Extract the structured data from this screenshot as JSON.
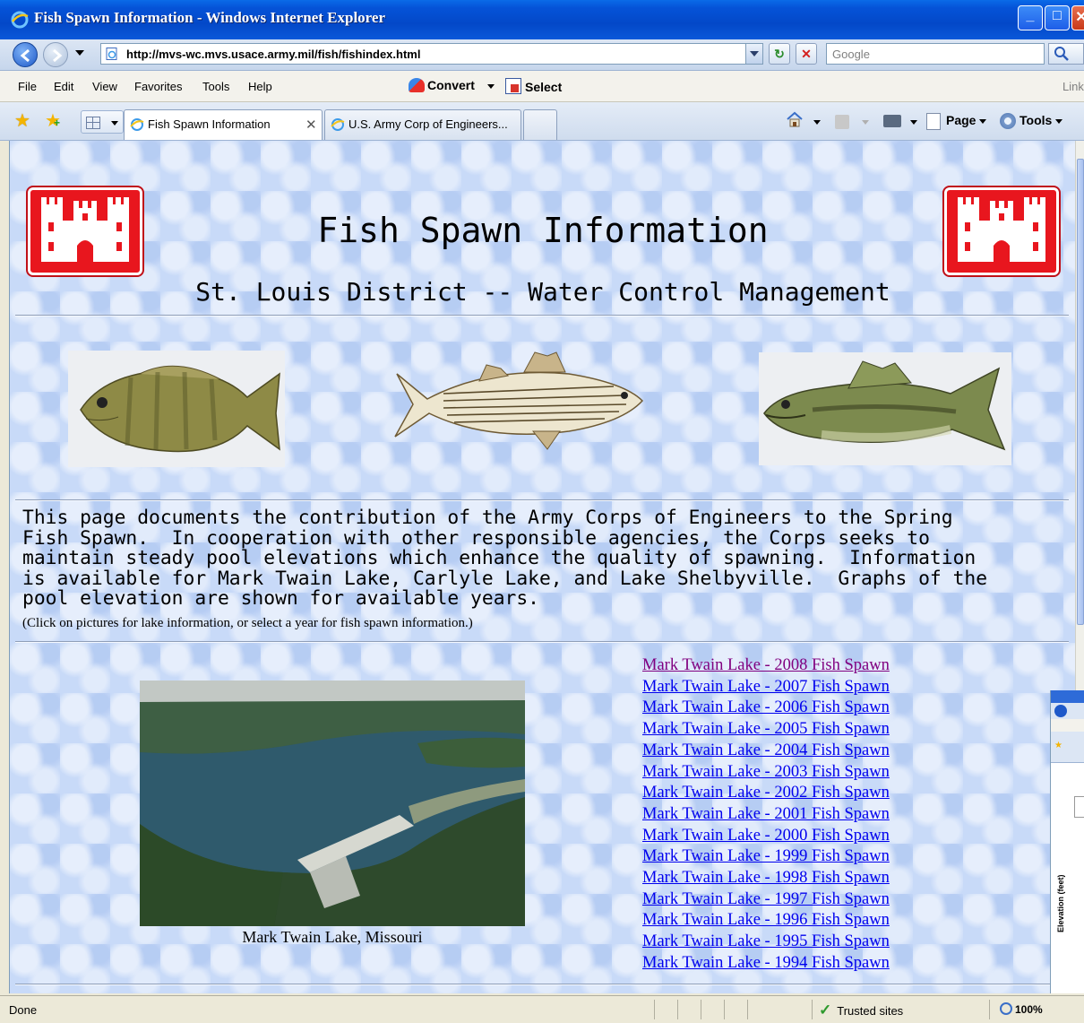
{
  "window": {
    "title": "Fish Spawn Information - Windows Internet Explorer"
  },
  "address_bar": {
    "url": "http://mvs-wc.mvs.usace.army.mil/fish/fishindex.html",
    "search_placeholder": "Google"
  },
  "menu": {
    "items": [
      "File",
      "Edit",
      "View",
      "Favorites",
      "Tools",
      "Help"
    ],
    "convert_label": "Convert",
    "select_label": "Select",
    "links_label": "Link"
  },
  "tabs": [
    {
      "label": "Fish Spawn Information",
      "active": true
    },
    {
      "label": "U.S. Army Corp of Engineers...",
      "active": false
    }
  ],
  "command_bar": {
    "page_label": "Page",
    "tools_label": "Tools"
  },
  "page": {
    "title": "Fish Spawn Information",
    "subtitle": "St. Louis District -- Water Control Management",
    "intro_lines": [
      "This page documents the contribution of the Army Corps of Engineers to the Spring",
      "Fish Spawn.  In cooperation with other responsible agencies, the Corps seeks to",
      "maintain steady pool elevations which enhance the quality of spawning.  Information",
      "is available for Mark Twain Lake, Carlyle Lake, and Lake Shelbyville.  Graphs of the",
      "pool elevation are shown for available years."
    ],
    "note": "(Click on pictures for lake information, or select a year for fish spawn information.)",
    "lake_caption": "Mark Twain Lake, Missouri",
    "links": [
      {
        "label": "Mark Twain Lake - 2008 Fish Spawn",
        "visited": true
      },
      {
        "label": "Mark Twain Lake - 2007 Fish Spawn",
        "visited": false
      },
      {
        "label": "Mark Twain Lake - 2006 Fish Spawn",
        "visited": false
      },
      {
        "label": "Mark Twain Lake - 2005 Fish Spawn",
        "visited": false
      },
      {
        "label": "Mark Twain Lake - 2004 Fish Spawn",
        "visited": false
      },
      {
        "label": "Mark Twain Lake - 2003 Fish Spawn",
        "visited": false
      },
      {
        "label": "Mark Twain Lake - 2002 Fish Spawn",
        "visited": false
      },
      {
        "label": "Mark Twain Lake - 2001 Fish Spawn",
        "visited": false
      },
      {
        "label": "Mark Twain Lake - 2000 Fish Spawn",
        "visited": false
      },
      {
        "label": "Mark Twain Lake - 1999 Fish Spawn",
        "visited": false
      },
      {
        "label": "Mark Twain Lake - 1998 Fish Spawn ",
        "visited": false
      },
      {
        "label": "Mark Twain Lake - 1997 Fish Spawn",
        "visited": false
      },
      {
        "label": "Mark Twain Lake - 1996 Fish Spawn",
        "visited": false
      },
      {
        "label": "Mark Twain Lake - 1995 Fish Spawn",
        "visited": false
      },
      {
        "label": "Mark Twain Lake - 1994 Fish Spawn",
        "visited": false
      }
    ]
  },
  "side_window": {
    "axis_label": "Elevation (feet)"
  },
  "status_bar": {
    "text": "Done",
    "zone": "Trusted sites",
    "zoom": "100%"
  },
  "colors": {
    "link": "#0000EE",
    "visited_link": "#800080",
    "corps_red": "#E8161E",
    "page_background": "#C8DAF8"
  }
}
